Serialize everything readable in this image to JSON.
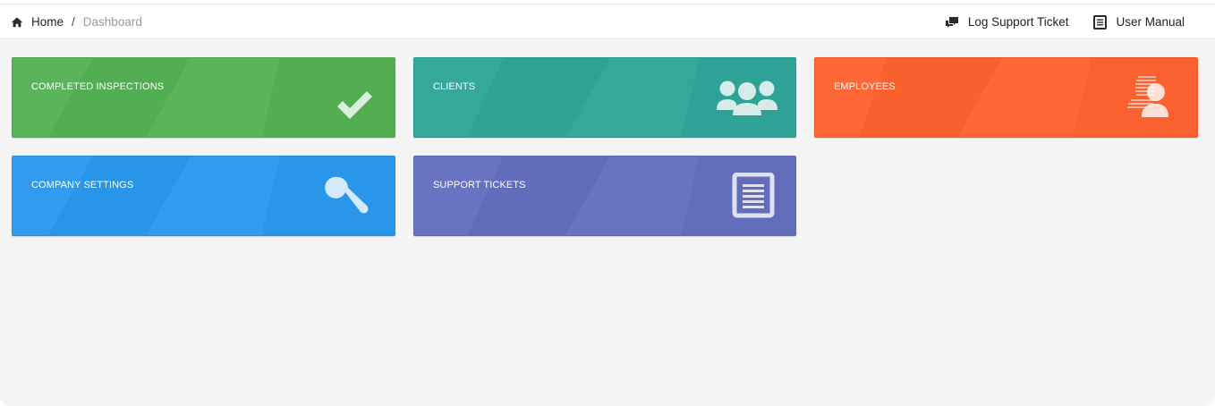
{
  "breadcrumb": {
    "home_label": "Home",
    "separator": "/",
    "current_label": "Dashboard"
  },
  "top_actions": {
    "log_support_ticket": "Log Support Ticket",
    "user_manual": "User Manual"
  },
  "tiles": [
    {
      "label": "COMPLETED INSPECTIONS",
      "icon": "checkmark-icon",
      "color": "#55b254"
    },
    {
      "label": "CLIENTS",
      "icon": "users-group-icon",
      "color": "#2fa699"
    },
    {
      "label": "EMPLOYEES",
      "icon": "employees-icon",
      "color": "#ff6330"
    },
    {
      "label": "COMPANY SETTINGS",
      "icon": "wrench-icon",
      "color": "#2b99ee"
    },
    {
      "label": "SUPPORT TICKETS",
      "icon": "document-icon",
      "color": "#6470c0"
    }
  ],
  "colors": {
    "page_background": "#f4f4f4",
    "topbar_background": "#ffffff",
    "breadcrumb_current": "#9a9a9a"
  }
}
